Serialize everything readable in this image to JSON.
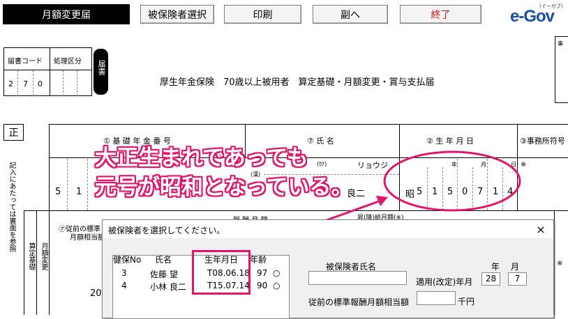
{
  "toolbar": {
    "title": "月額変更届",
    "select_insured": "被保険者選択",
    "print": "印刷",
    "copy": "副へ",
    "exit": "終了",
    "logo": "e-Gov",
    "logo_sub": "(イーガブ)"
  },
  "form": {
    "code_label": "届書コード",
    "kubun_label": "処理区分",
    "todoke": "届書",
    "code_digits": [
      "2",
      "7",
      "0"
    ],
    "main_title": "厚生年金保険　70歳以上被用者　算定基礎・月額変更・賞与支払届",
    "sei": "正",
    "corner_label": "事",
    "col1_header": "① 基 礎 年 金 番 号",
    "col2_header": "⑦ 氏 名",
    "col3_header": "② 生 年 月 日",
    "col4_header": "③事務所符号",
    "furigana": "リョウジ",
    "name_part": "良二",
    "ka_mark": "(ｶﾅ)",
    "kan_mark": "(漢)",
    "row_digits": [
      "5",
      "1"
    ],
    "era": "昭",
    "birth_digits": [
      "5",
      "1",
      "5",
      "0",
      "7",
      "1",
      "4"
    ],
    "birth_units": [
      "年",
      "月",
      "日"
    ],
    "asterisk": "※",
    "prev_label": "㋐従前の標準",
    "prev_label2": "月額相当額",
    "middle_text": "報 酬 月 額",
    "right_text": "昇(降)給月額(※)",
    "left_vertical": "記入にあたっては裏面を参照",
    "row_label_a": "算定基礎",
    "row_label_b": "月額変更",
    "partial_number": "20"
  },
  "callout": {
    "line1": "大正生まれであっても",
    "line2": "元号が昭和となっている。",
    "color": "#e0156b"
  },
  "dialog": {
    "title": "被保険者を選択してください。",
    "columns": [
      "健保No",
      "氏名",
      "生年月日",
      "年齢"
    ],
    "rows": [
      {
        "no": "3",
        "name": "佐藤 望",
        "birth": "T08.06.18",
        "age": "97",
        "mark": "○"
      },
      {
        "no": "4",
        "name": "小林 良二",
        "birth": "T15.07.14",
        "age": "90",
        "mark": "○"
      }
    ],
    "insured_name_label": "被保険者氏名",
    "year_label": "年",
    "month_label": "月",
    "apply_label": "適用(改定)年月",
    "apply_year": "28",
    "apply_month": "7",
    "prev_amount_label": "従前の標準報酬月額相当額",
    "unit": "千円",
    "close_symbol": "×"
  }
}
